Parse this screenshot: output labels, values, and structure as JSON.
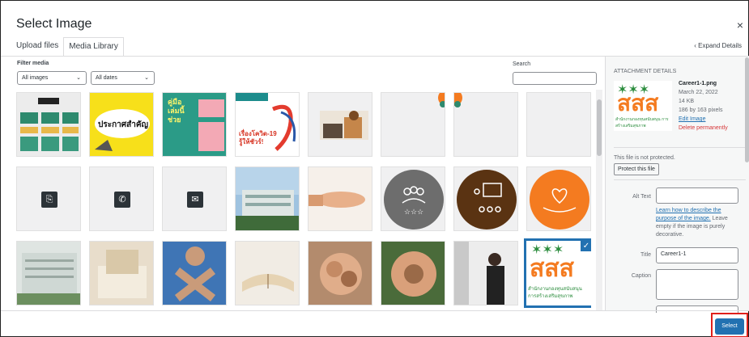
{
  "dialog": {
    "title": "Select Image",
    "close_glyph": "×"
  },
  "tabs": [
    {
      "label": "Upload files",
      "active": false
    },
    {
      "label": "Media Library",
      "active": true
    }
  ],
  "expand_details": "‹ Expand Details",
  "filters": {
    "label": "Filter media",
    "type_value": "All images",
    "date_value": "All dates",
    "search_label": "Search",
    "search_value": ""
  },
  "icons": {
    "chevron": "chevron-down-icon",
    "print": "print-icon",
    "phone": "phone-icon",
    "email": "email-icon",
    "check": "checkmark-icon"
  },
  "grid_text": {
    "thai_1": "ประกาศสำคัญ",
    "thai_2": "คู่มือ เล่มนี้ ช่วย",
    "thai_3": "เรื่องโควิด-19 รู้ให้ชัวร์!",
    "thai_logo": "สสส",
    "thai_logo_sub": "สำนักงานกองทุนสนับสนุน การสร้างเสริมสุขภาพ"
  },
  "details": {
    "heading": "ATTACHMENT DETAILS",
    "filename": "Career1-1.png",
    "date": "March 22, 2022",
    "size": "14 KB",
    "dimensions": "186 by 163 pixels",
    "edit_link": "Edit Image",
    "delete_link": "Delete permanently",
    "protect_note": "This file is not protected.",
    "protect_button": "Protect this file",
    "alt_label": "Alt Text",
    "alt_value": "",
    "alt_help_link": "Learn how to describe the purpose of the image.",
    "alt_help_text": " Leave empty if the image is purely decorative.",
    "title_label": "Title",
    "title_value": "Career1-1",
    "caption_label": "Caption"
  },
  "footer": {
    "select_label": "Select"
  },
  "colors": {
    "accent": "#2271b1",
    "highlight": "#e0201b",
    "orange": "#f47b20",
    "brown": "#5a3312",
    "gray_circle": "#6d6d6d"
  }
}
